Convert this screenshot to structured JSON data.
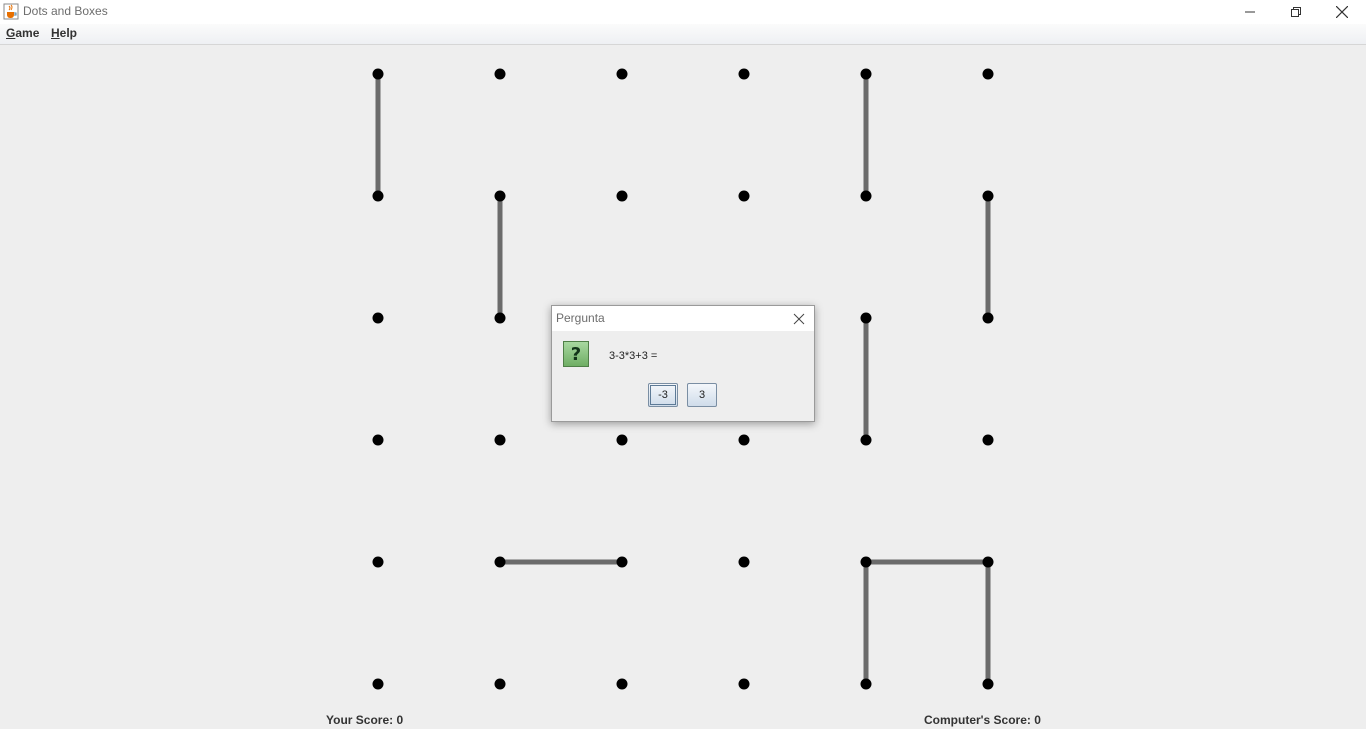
{
  "window": {
    "title": "Dots and Boxes",
    "icon": "java-cup-icon"
  },
  "menu": {
    "items": [
      {
        "mnemonic": "G",
        "rest": "ame"
      },
      {
        "mnemonic": "H",
        "rest": "elp"
      }
    ]
  },
  "board": {
    "grid_columns": 6,
    "grid_rows": 6,
    "dot_color": "#000000",
    "line_color": "#6b6b6b",
    "lines": [
      {
        "type": "v",
        "col": 0,
        "row": 0
      },
      {
        "type": "v",
        "col": 4,
        "row": 0
      },
      {
        "type": "v",
        "col": 1,
        "row": 1
      },
      {
        "type": "v",
        "col": 5,
        "row": 1
      },
      {
        "type": "v",
        "col": 4,
        "row": 2
      },
      {
        "type": "h",
        "col": 1,
        "row": 4
      },
      {
        "type": "h",
        "col": 4,
        "row": 4
      },
      {
        "type": "v",
        "col": 4,
        "row": 4
      },
      {
        "type": "v",
        "col": 5,
        "row": 4
      }
    ]
  },
  "scores": {
    "player": "Your Score: 0",
    "computer": "Computer's Score: 0"
  },
  "dialog": {
    "title": "Pergunta",
    "icon": "question-icon",
    "icon_glyph": "?",
    "question": "3-3*3+3 =",
    "answers": [
      "-3",
      "3"
    ]
  }
}
